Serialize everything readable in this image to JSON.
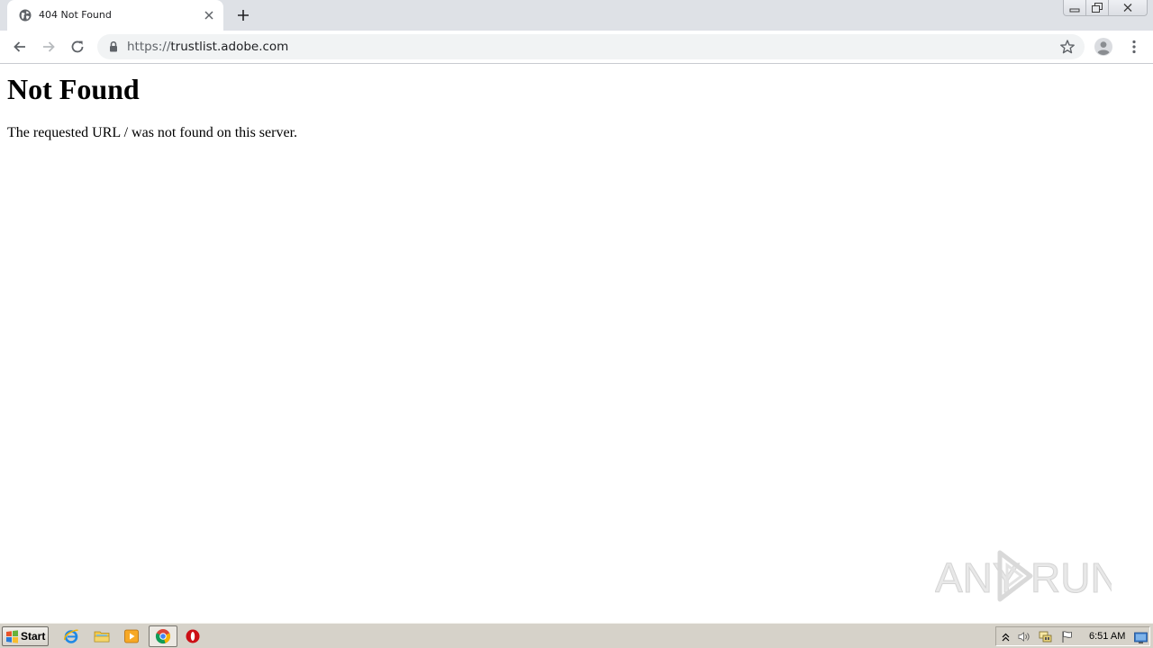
{
  "browser": {
    "tab": {
      "title": "404 Not Found"
    },
    "omnibox": {
      "scheme": "https://",
      "host": "trustlist.adobe.com"
    }
  },
  "page": {
    "heading": "Not Found",
    "message": "The requested URL / was not found on this server."
  },
  "watermark": {
    "left": "ANY",
    "right": "RUN"
  },
  "taskbar": {
    "start_label": "Start",
    "clock": "6:51 AM"
  },
  "icons": {
    "tab_favicon": "globe-icon",
    "tab_close": "close-icon",
    "new_tab": "plus-icon",
    "back": "arrow-left-icon",
    "forward": "arrow-right-icon",
    "reload": "reload-icon",
    "lock": "lock-icon",
    "bookmark": "star-icon",
    "profile": "profile-icon",
    "menu": "kebab-menu-icon"
  },
  "colors": {
    "tabstrip": "#dee1e6",
    "omnibox": "#f1f3f4",
    "taskbar": "#d6d2c9"
  }
}
